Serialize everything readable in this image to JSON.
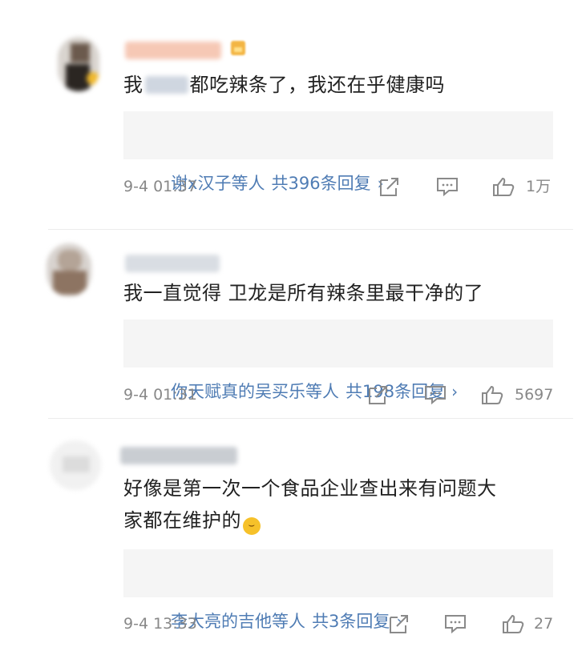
{
  "comments": [
    {
      "text_before": "我",
      "text_after": "都吃辣条了，我还在乎健康吗",
      "replies": {
        "users": "谢x汉子等人",
        "count": "共396条回复",
        "arrow": "›"
      },
      "time": "9-4 01:37",
      "likes": "1万",
      "icons": [
        "share-icon",
        "comment-icon",
        "like-icon"
      ]
    },
    {
      "text": "我一直觉得 卫龙是所有辣条里最干净的了",
      "replies": {
        "users": "你天赋真的吴买乐等人",
        "count": "共198条回复",
        "arrow": "›"
      },
      "time": "9-4 01:31",
      "likes": "5697",
      "icons": [
        "share-icon",
        "comment-icon",
        "like-icon"
      ]
    },
    {
      "text_line1": "好像是第一次一个食品企业查出来有问题大",
      "text_line2": "家都在维护的",
      "emoji": "laughing-tears-emoji",
      "replies": {
        "users": "李大亮的吉他等人",
        "count": "共3条回复",
        "arrow": "›"
      },
      "time": "9-4 13:33",
      "likes": "27",
      "icons": [
        "share-icon",
        "comment-icon",
        "like-icon"
      ]
    }
  ],
  "colors": {
    "link": "#4f7cb4",
    "text": "#222222",
    "meta": "#888888",
    "reply_bg": "#f5f5f5"
  }
}
